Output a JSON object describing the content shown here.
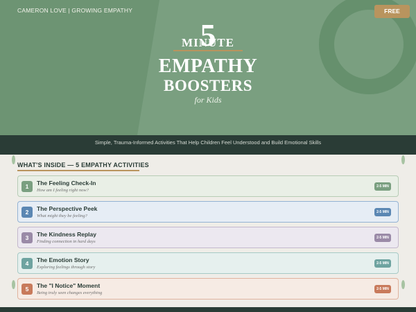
{
  "header": {
    "brand": "CAMERON LOVE  |  GROWING EMPATHY",
    "free_label": "FREE"
  },
  "hero": {
    "number": "5",
    "minute": "MINUTE",
    "title_line1": "EMPATHY",
    "title_line2": "BOOSTERS",
    "subtitle": "for Kids"
  },
  "tagline": "Simple, Trauma-Informed Activities That Help Children Feel Understood and Build Emotional Skills",
  "section": {
    "heading": "WHAT'S INSIDE  —  5 EMPATHY ACTIVITIES"
  },
  "activities": [
    {
      "num": "1",
      "title": "The Feeling Check-In",
      "subtitle": "How am I feeling right now?",
      "badge": "2-5 MIN",
      "color": "#7a9f80",
      "bg": "#e9efe6",
      "border": "#b7ccb5"
    },
    {
      "num": "2",
      "title": "The Perspective Peek",
      "subtitle": "What might they be feeling?",
      "badge": "2-5 MIN",
      "color": "#5b87b3",
      "bg": "#e6edf5",
      "border": "#94b3d3"
    },
    {
      "num": "3",
      "title": "The Kindness Replay",
      "subtitle": "Finding connection in hard days",
      "badge": "2-5 MIN",
      "color": "#9a8aa7",
      "bg": "#ece8f0",
      "border": "#c3b8cd"
    },
    {
      "num": "4",
      "title": "The Emotion Story",
      "subtitle": "Exploring feelings through story",
      "badge": "2-5 MIN",
      "color": "#6ea3a0",
      "bg": "#e6f0ee",
      "border": "#a7cac6"
    },
    {
      "num": "5",
      "title": "The \"I Notice\" Moment",
      "subtitle": "Being truly seen changes everything",
      "badge": "2-5 MIN",
      "color": "#c87a5b",
      "bg": "#f6ebe4",
      "border": "#e0b39e"
    }
  ]
}
